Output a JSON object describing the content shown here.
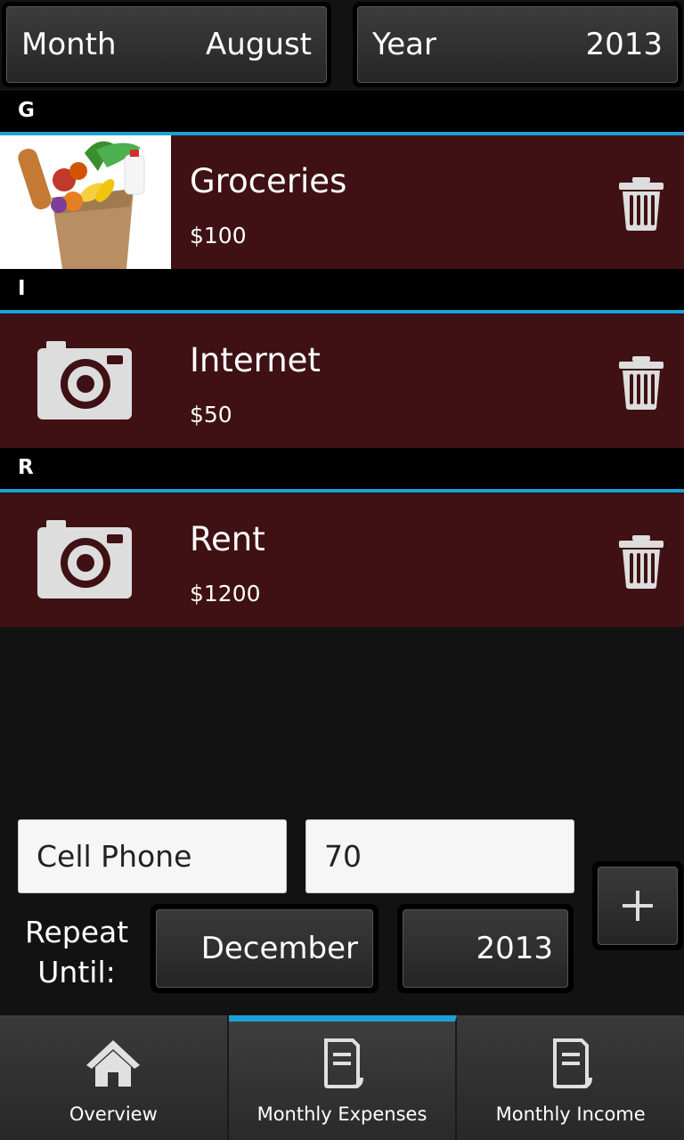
{
  "selectors": {
    "month_label": "Month",
    "month_value": "August",
    "year_label": "Year",
    "year_value": "2013"
  },
  "expenses": [
    {
      "header": "G",
      "name": "Groceries",
      "amount": "$100",
      "thumbnail": "groceries-photo"
    },
    {
      "header": "I",
      "name": "Internet",
      "amount": "$50",
      "thumbnail": "camera-icon"
    },
    {
      "header": "R",
      "name": "Rent",
      "amount": "$1200",
      "thumbnail": "camera-icon"
    }
  ],
  "form": {
    "name_value": "Cell Phone",
    "amount_value": "70",
    "repeat_label_line1": "Repeat",
    "repeat_label_line2": "Until:",
    "until_month": "December",
    "until_year": "2013",
    "add_icon": "plus-icon"
  },
  "tabs": [
    {
      "label": "Overview",
      "icon": "home-icon",
      "active": false
    },
    {
      "label": "Monthly Expenses",
      "icon": "document-icon",
      "active": true
    },
    {
      "label": "Monthly Income",
      "icon": "document-icon",
      "active": false
    }
  ],
  "colors": {
    "accent": "#1ea0d6",
    "item_background": "#3f1114",
    "page_background": "#121212"
  }
}
